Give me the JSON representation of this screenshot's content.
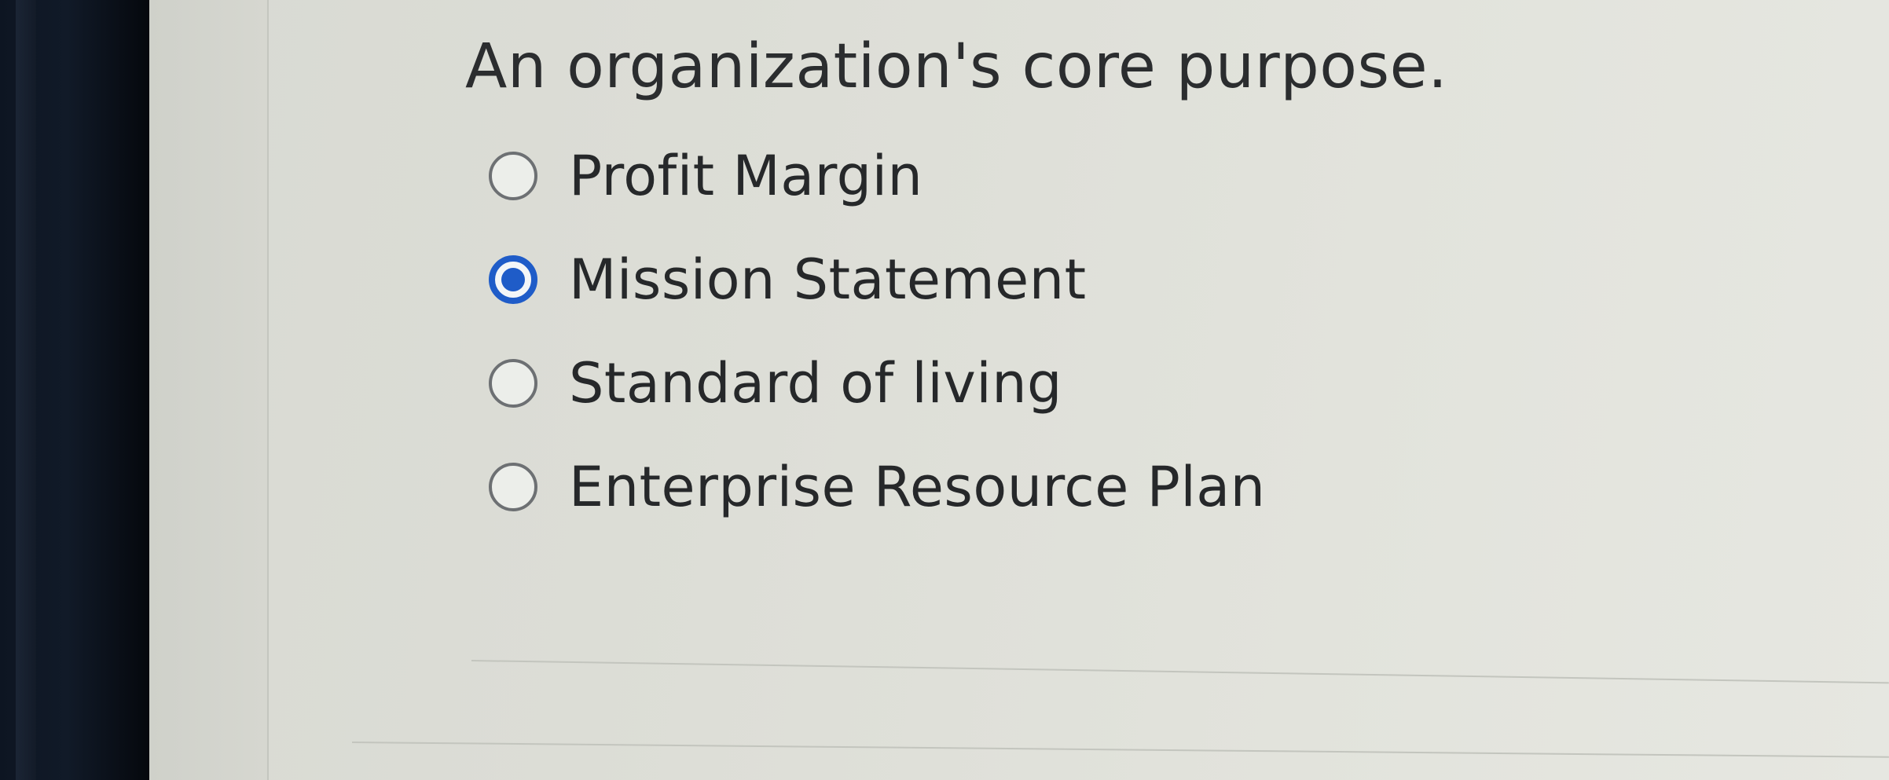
{
  "question": {
    "text": "An organization's core purpose.",
    "options": [
      {
        "label": "Profit Margin",
        "selected": false
      },
      {
        "label": "Mission Statement",
        "selected": true
      },
      {
        "label": "Standard of living",
        "selected": false
      },
      {
        "label": "Enterprise Resource Plan",
        "selected": false
      }
    ]
  },
  "colors": {
    "accent": "#1f5cc8",
    "text": "#26282a",
    "background": "#dcddd6"
  }
}
